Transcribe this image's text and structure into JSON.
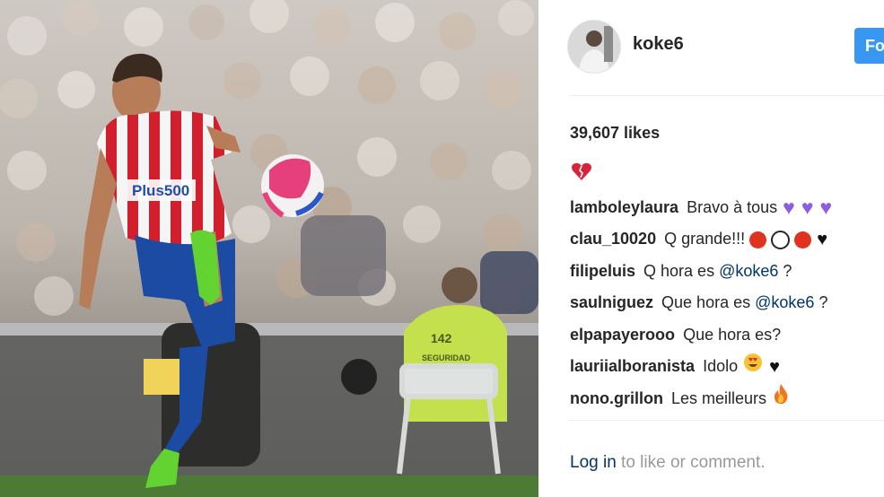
{
  "post": {
    "username": "koke6",
    "follow_label": "Fo",
    "likes": "39,607 likes",
    "comments": [
      {
        "user": "",
        "text": "",
        "emoji": [
          "broken-heart"
        ]
      },
      {
        "user": "lamboleylaura",
        "text": "Bravo à tous",
        "emoji": [
          "purple-heart",
          "purple-heart",
          "purple-heart"
        ]
      },
      {
        "user": "clau_10020",
        "text": "Q grande!!!",
        "emoji": [
          "red-circle",
          "white-circle",
          "red-circle",
          "black-heart"
        ]
      },
      {
        "user": "filipeluis",
        "text": "Q hora es",
        "mention": "@koke6",
        "after": "?",
        "emoji": []
      },
      {
        "user": "saulniguez",
        "text": "Que hora es",
        "mention": "@koke6",
        "after": "?",
        "emoji": []
      },
      {
        "user": "elpapayerooo",
        "text": "Que hora es?",
        "emoji": []
      },
      {
        "user": "lauriialboranista",
        "text": "Idolo",
        "emoji": [
          "heart-eyes",
          "black-heart"
        ]
      },
      {
        "user": "nono.grillon",
        "text": "Les meilleurs",
        "emoji": [
          "fire"
        ]
      }
    ],
    "login_link": "Log in",
    "login_text": " to like or comment.",
    "photo_text": {
      "sponsor": "Plus500",
      "number": "142",
      "vest": "SEGURIDAD"
    }
  },
  "colors": {
    "accent": "#3897f0",
    "link": "#003569",
    "muted": "#999999",
    "text": "#262626"
  }
}
